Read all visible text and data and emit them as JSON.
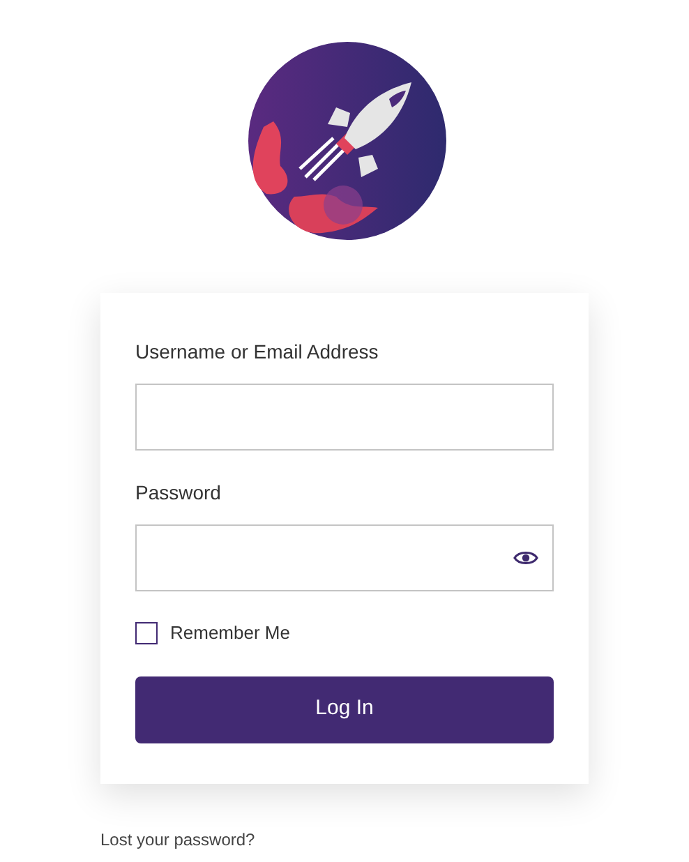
{
  "login_form": {
    "username": {
      "label": "Username or Email Address"
    },
    "password": {
      "label": "Password"
    },
    "remember_me": {
      "label": "Remember Me",
      "checked": false
    },
    "submit": {
      "label": "Log In"
    }
  },
  "lost_password_link": "Lost your password?"
}
